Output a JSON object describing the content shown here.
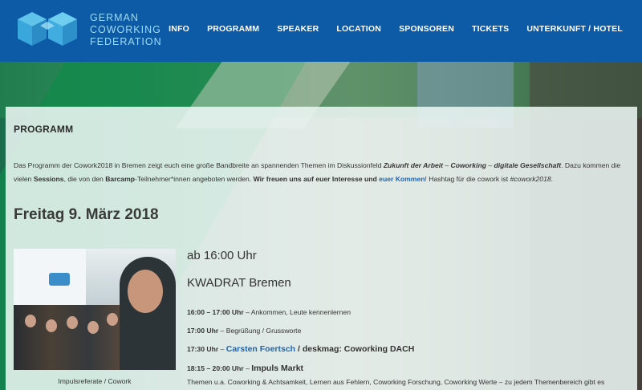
{
  "header": {
    "logo_lines": [
      "GERMAN",
      "COWORKING",
      "FEDERATION"
    ],
    "nav": [
      "INFO",
      "PROGRAMM",
      "SPEAKER",
      "LOCATION",
      "SPONSOREN",
      "TICKETS",
      "UNTERKUNFT / HOTEL"
    ]
  },
  "section": {
    "title": "PROGRAMM",
    "intro": {
      "p1": "Das Programm der Cowork2018 in Bremen zeigt euch eine große Bandbreite an spannenden Themen im Diskussionfeld ",
      "em1": "Zukunft der Arbeit",
      "sep1": " – ",
      "em2": "Coworking",
      "sep2": " – ",
      "em3": "digitale Gesellschaft",
      "p2": ". Dazu kommen die vielen ",
      "b1": "Sessions",
      "p3": ", die von den ",
      "b2": "Barcamp",
      "p4": "-Teilnehmer*innen angeboten werden. ",
      "b3": "Wir freuen uns auf euer Interesse und",
      "link": "euer Kommen",
      "p5": "! Hashtag für die cowork ist ",
      "hashtag": "#cowork2018",
      "p6": "."
    }
  },
  "day": {
    "title": "Freitag 9. März 2018",
    "photo_caption": "Impulsreferate / Cowork",
    "start_time": "ab 16:00 Uhr",
    "venue": "KWADRAT Bremen",
    "items": [
      {
        "time": "16:00 – 17:00 Uhr",
        "sep": " – ",
        "text": "Ankommen, Leute kennenlernen"
      },
      {
        "time": "17:00 Uhr",
        "sep": " – ",
        "text": "Begrüßung / Grussworte"
      },
      {
        "time": "17:30 Uhr",
        "sep": " – ",
        "link": "Carsten Foertsch",
        "text": " / deskmag: Coworking DACH"
      },
      {
        "time": "18:15 – 20:00 Uhr",
        "sep": " – ",
        "text": "Impuls Markt"
      }
    ],
    "topics_line": "Themen u.a. Coworking & Achtsamkeit, Lernen aus Fehlern, Coworking Forschung, Coworking Werte – zu jedem Themenbereich gibt es"
  }
}
